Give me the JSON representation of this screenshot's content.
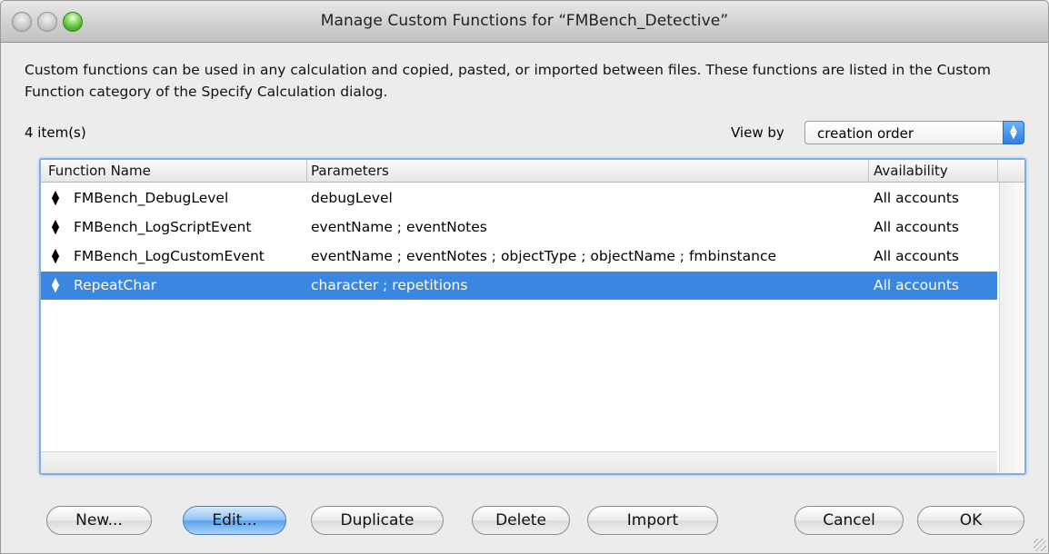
{
  "window": {
    "title": "Manage Custom Functions for “FMBench_Detective”"
  },
  "description": "Custom functions can be used in any calculation and copied, pasted, or imported between files. These functions are listed in the Custom Function category of the Specify Calculation dialog.",
  "item_count": "4 item(s)",
  "view_by": {
    "label": "View by",
    "selected": "creation order"
  },
  "table": {
    "columns": [
      "Function Name",
      "Parameters",
      "Availability"
    ],
    "rows": [
      {
        "name": "FMBench_DebugLevel",
        "params": "debugLevel",
        "availability": "All accounts"
      },
      {
        "name": "FMBench_LogScriptEvent",
        "params": "eventName ; eventNotes",
        "availability": "All accounts"
      },
      {
        "name": "FMBench_LogCustomEvent",
        "params": "eventName ; eventNotes ; objectType ; objectName ; fmbinstance",
        "availability": "All accounts"
      },
      {
        "name": "RepeatChar",
        "params": "character ; repetitions",
        "availability": "All accounts"
      }
    ],
    "selected_row": 3
  },
  "buttons": {
    "new": "New...",
    "edit": "Edit...",
    "duplicate": "Duplicate",
    "delete": "Delete",
    "import": "Import",
    "cancel": "Cancel",
    "ok": "OK"
  },
  "colors": {
    "selection": "#3a86e0",
    "default_button": "#5aa2ee"
  }
}
